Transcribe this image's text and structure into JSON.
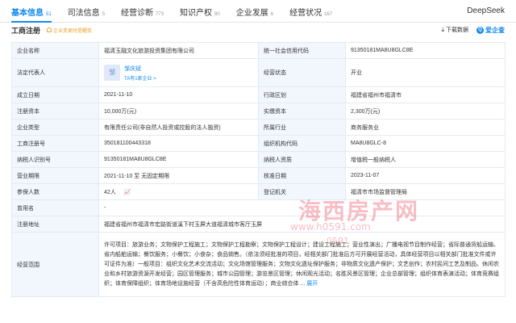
{
  "nav": {
    "tabs": [
      {
        "label": "基本信息",
        "count": "51"
      },
      {
        "label": "司法信息",
        "count": "5"
      },
      {
        "label": "经营诊断",
        "count": "773"
      },
      {
        "label": "知识产权",
        "count": "80"
      },
      {
        "label": "企业发展",
        "count": "6"
      },
      {
        "label": "经营状况",
        "count": "167"
      }
    ],
    "deepseek": "DeepSeek"
  },
  "section": {
    "title": "工商注册",
    "alert": "企业变更时提醒我",
    "download": "下载数据",
    "logo": "爱企查"
  },
  "rows": {
    "company_name_k": "企业名称",
    "company_name_v": "福清玉融文化旅游投资集团有限公司",
    "credit_code_k": "统一社会信用代码",
    "credit_code_v": "91350181MA8U8GLC8E",
    "legal_rep_k": "法定代表人",
    "legal_rep_name": "邹庆斌",
    "legal_rep_tag": "TA有1家企业 >",
    "status_k": "经营状态",
    "status_v": "开业",
    "founded_k": "成立日期",
    "founded_v": "2021-11-10",
    "region_k": "行政区划",
    "region_v": "福建省福州市福清市",
    "reg_capital_k": "注册资本",
    "reg_capital_v": "10,000万(元)",
    "paid_capital_k": "实缴资本",
    "paid_capital_v": "2,300万(元)",
    "type_k": "企业类型",
    "type_v": "有限责任公司(非自然人投资或控股的法人独资)",
    "industry_k": "所属行业",
    "industry_v": "商务服务业",
    "reg_no_k": "工商注册号",
    "reg_no_v": "350181100443318",
    "org_code_k": "组织机构代码",
    "org_code_v": "MA8U8GLC-8",
    "taxpayer_id_k": "纳税人识别号",
    "taxpayer_id_v": "91350181MA8U8GLC8E",
    "taxpayer_qual_k": "纳税人资质",
    "taxpayer_qual_v": "增值税一般纳税人",
    "term_k": "营业期限",
    "term_v": "2021-11-10 至 无固定期限",
    "approval_k": "核准日期",
    "approval_v": "2023-11-07",
    "insured_k": "参保人数",
    "insured_v": "42人",
    "authority_k": "登记机关",
    "authority_v": "福清市市场监督管理局",
    "former_name_k": "曾用名",
    "former_name_v": "-",
    "address_k": "注册地址",
    "address_v": "福建省福州市福清市宏路街道溪下村玉屏大道福清城市客厅玉屏",
    "scope_k": "经营范围",
    "scope_v": "许可项目：旅游业务；文物保护工程施工；文物保护工程勘察；文物保护工程设计；建设工程施工；营业性演出；广播电视节目制作经营；省际普通货船运输、省内船舶运输；餐饮服务；小餐饮；小食杂；食品销售。（依法须经批准的项目，经相关部门批准后方可开展经营活动，具体经营项目以相关部门批准文件或许可证件为准）一般项目：组织文化艺术交流活动；文化场馆管理服务；文物文化遗址保护服务；非物质文化遗产保护；文艺创作；农村民间工艺及制品、休闲农业和乡村旅游资源开发经营；园区管理服务；城市公园管理；游览景区管理；休闲观光活动；名胜风景区管理；企业总部管理；组织体育表演活动；体育竞赛组织；体育保障组织；体育场地设施经营（不含高危险性体育运动）；商业综合体",
    "scope_expand": "展开"
  },
  "watermark": {
    "main": "海西房产网",
    "url": "www.h0591.com",
    "phone": "0591"
  },
  "colors": {
    "accent": "#128bed",
    "key_bg": "#f2f7fe",
    "border": "#e4eaf2",
    "alert": "#f0a030"
  }
}
